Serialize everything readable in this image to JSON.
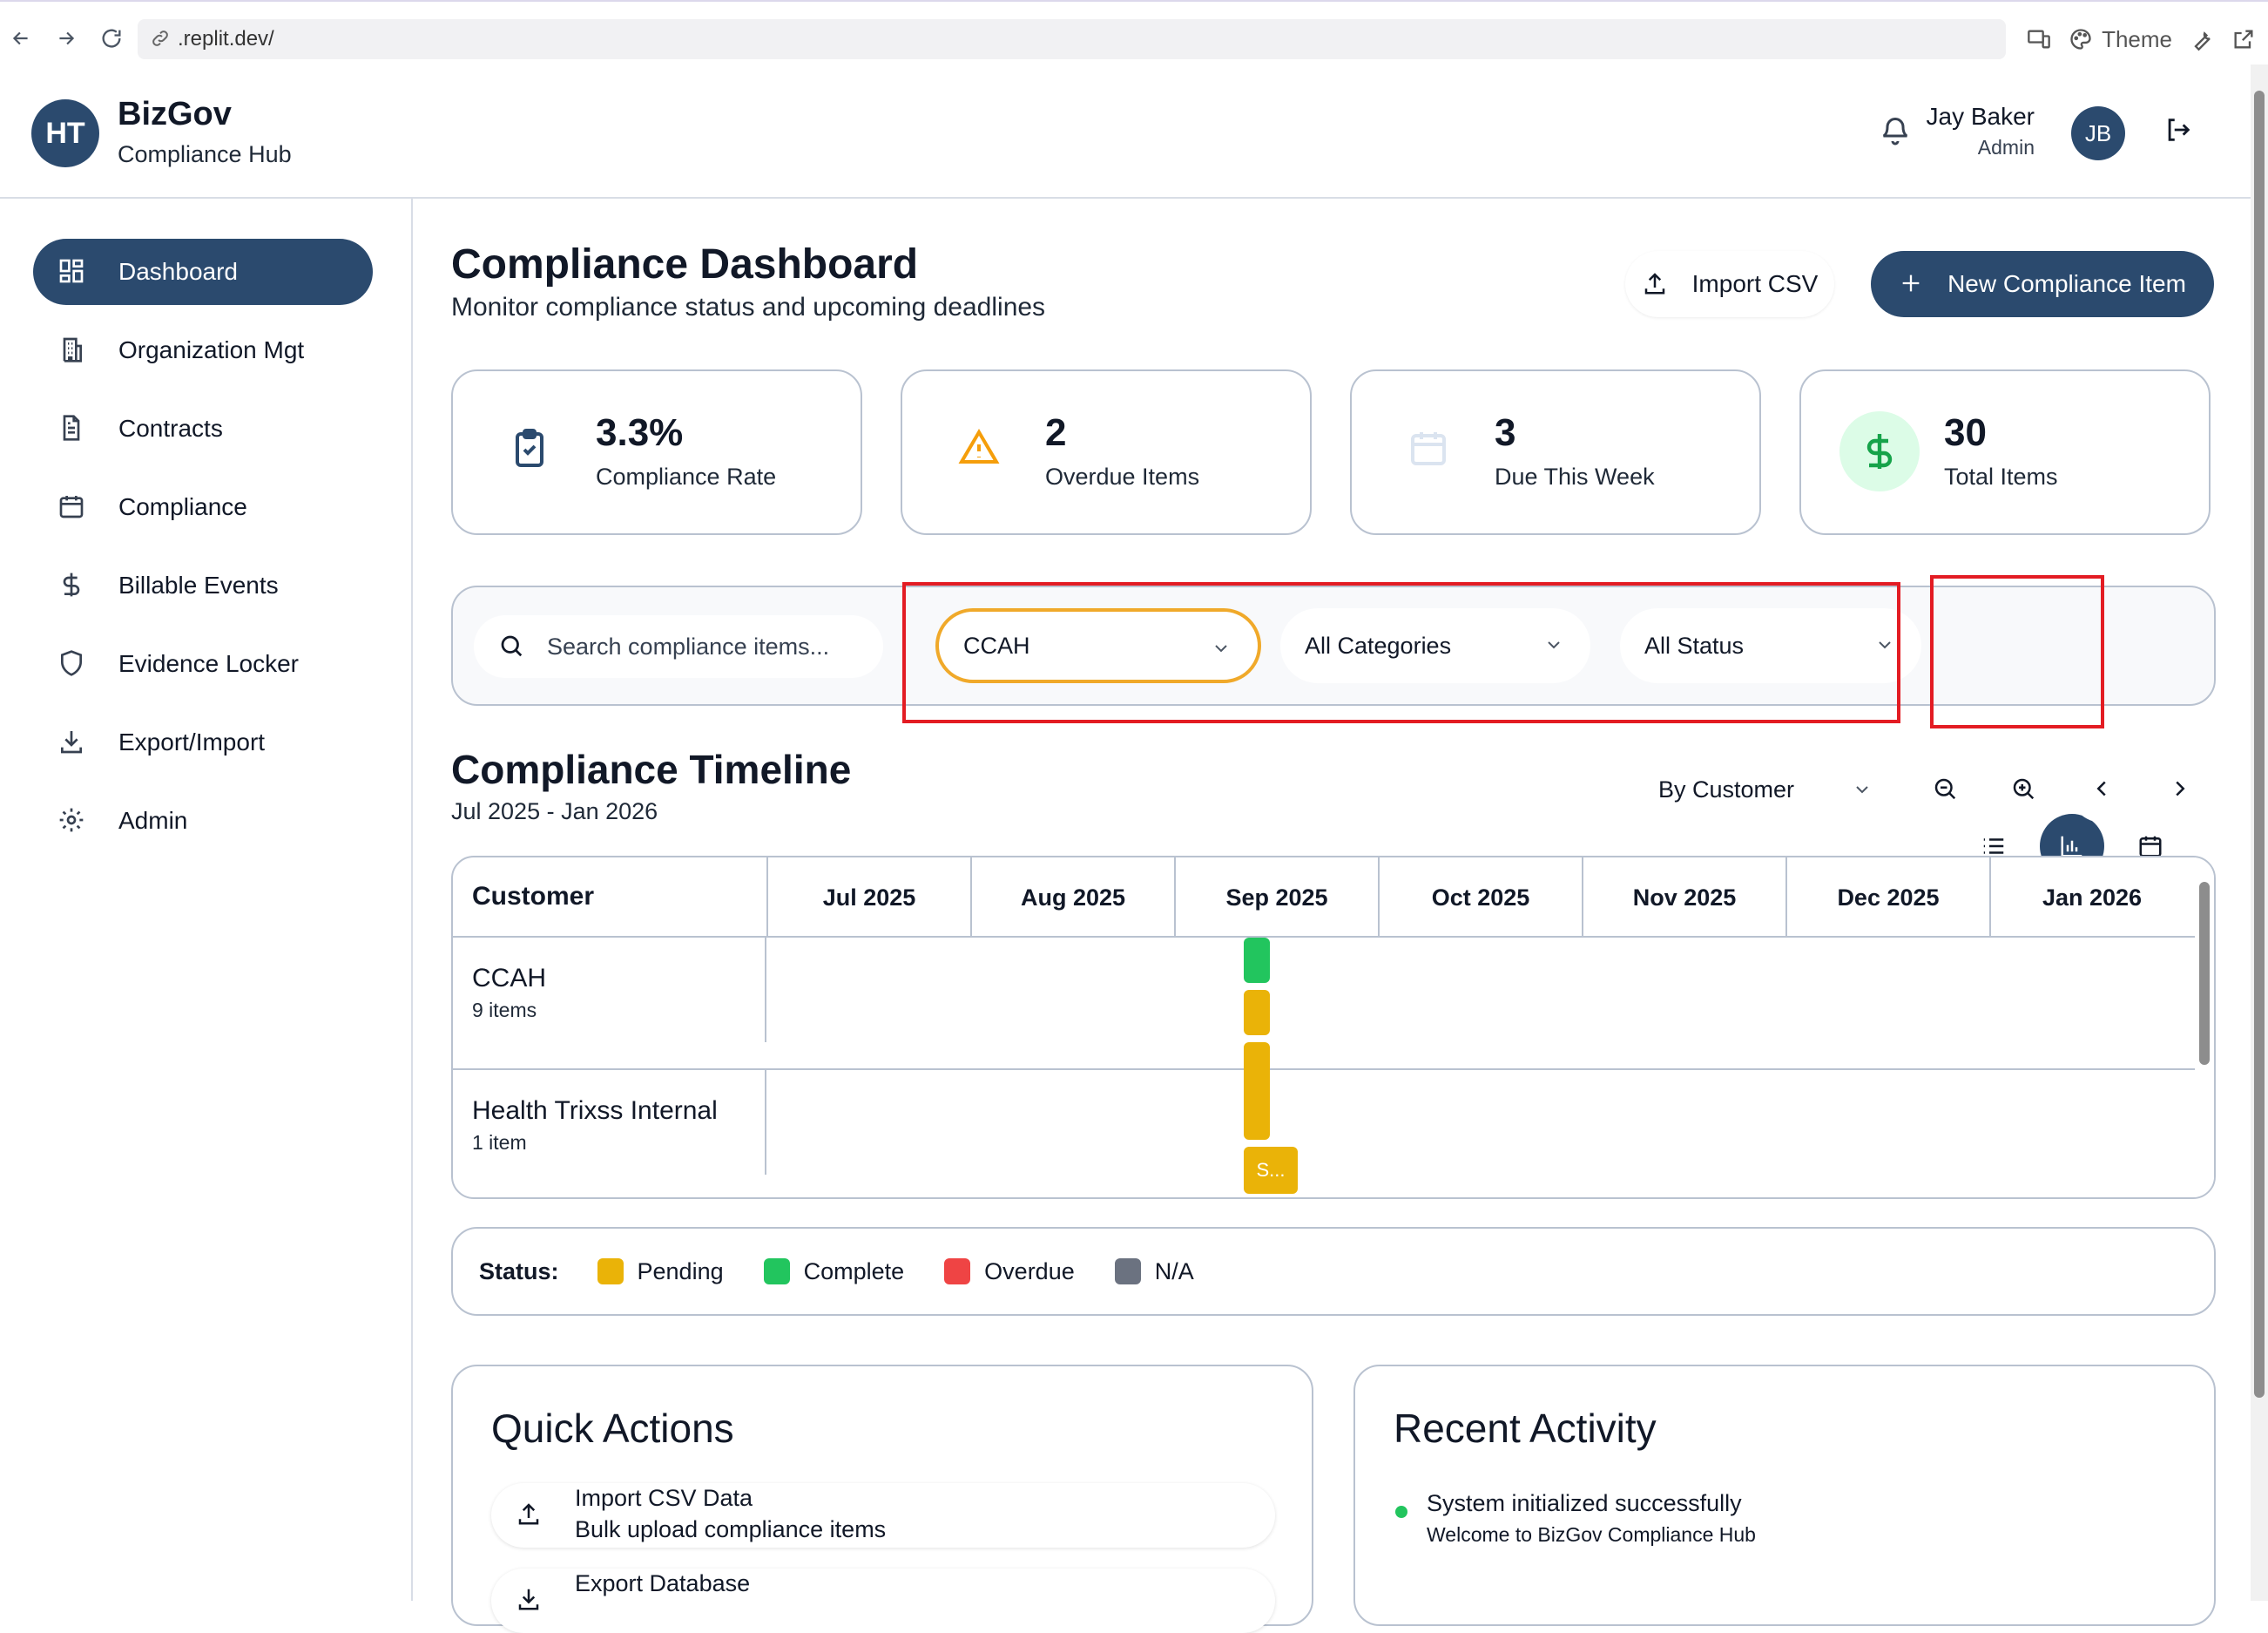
{
  "browser": {
    "url": ".replit.dev/",
    "theme_label": "Theme"
  },
  "header": {
    "logo_initials": "HT",
    "brand_name": "BizGov",
    "brand_subtitle": "Compliance Hub",
    "user_name": "Jay Baker",
    "user_role": "Admin",
    "user_initials": "JB"
  },
  "sidebar": {
    "items": [
      {
        "label": "Dashboard",
        "icon": "dashboard-grid-icon",
        "active": true
      },
      {
        "label": "Organization Mgt",
        "icon": "building-icon"
      },
      {
        "label": "Contracts",
        "icon": "document-icon"
      },
      {
        "label": "Compliance",
        "icon": "calendar-icon"
      },
      {
        "label": "Billable Events",
        "icon": "dollar-icon"
      },
      {
        "label": "Evidence Locker",
        "icon": "shield-icon"
      },
      {
        "label": "Export/Import",
        "icon": "download-icon"
      },
      {
        "label": "Admin",
        "icon": "gear-icon"
      }
    ]
  },
  "main": {
    "title": "Compliance Dashboard",
    "subtitle": "Monitor compliance status and upcoming deadlines",
    "import_label": "Import CSV",
    "new_item_label": "New Compliance Item",
    "stats": [
      {
        "value": "3.3%",
        "label": "Compliance Rate",
        "icon": "clipboard-check-icon"
      },
      {
        "value": "2",
        "label": "Overdue Items",
        "icon": "warning-icon"
      },
      {
        "value": "3",
        "label": "Due This Week",
        "icon": "calendar-icon"
      },
      {
        "value": "30",
        "label": "Total Items",
        "icon": "dollar-icon"
      }
    ],
    "filters": {
      "search_placeholder": "Search compliance items...",
      "customer": "CCAH",
      "category": "All Categories",
      "status": "All Status"
    }
  },
  "timeline": {
    "title": "Compliance Timeline",
    "range": "Jul 2025 - Jan 2026",
    "group_by": "By Customer",
    "column_header": "Customer",
    "months": [
      "Jul 2025",
      "Aug 2025",
      "Sep 2025",
      "Oct 2025",
      "Nov 2025",
      "Dec 2025",
      "Jan 2026"
    ],
    "rows": [
      {
        "name": "CCAH",
        "count": "9 items"
      },
      {
        "name": "Health Trixss Internal",
        "count": "1 item"
      }
    ],
    "truncated_bar_label": "S..."
  },
  "legend": {
    "title": "Status:",
    "items": [
      {
        "label": "Pending",
        "color": "#eab308"
      },
      {
        "label": "Complete",
        "color": "#22c55e"
      },
      {
        "label": "Overdue",
        "color": "#ef4444"
      },
      {
        "label": "N/A",
        "color": "#6b7280"
      }
    ]
  },
  "quick_actions": {
    "title": "Quick Actions",
    "items": [
      {
        "title": "Import CSV Data",
        "desc": "Bulk upload compliance items",
        "icon": "upload-icon"
      },
      {
        "title": "Export Database",
        "desc": "",
        "icon": "download-icon"
      }
    ]
  },
  "recent_activity": {
    "title": "Recent Activity",
    "items": [
      {
        "title": "System initialized successfully",
        "desc": "Welcome to BizGov Compliance Hub"
      }
    ]
  }
}
